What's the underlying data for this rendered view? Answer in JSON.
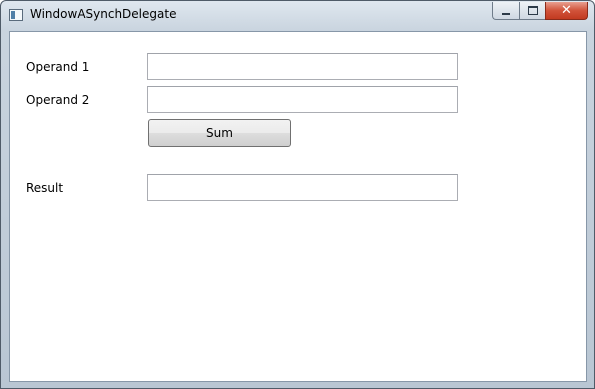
{
  "window": {
    "title": "WindowASynchDelegate",
    "icon": "wpf-window-icon",
    "caption_buttons": {
      "minimize": "minimize-icon",
      "maximize": "maximize-icon",
      "close": "close-icon",
      "close_glyph": "✕"
    }
  },
  "form": {
    "operand1": {
      "label": "Operand 1",
      "value": ""
    },
    "operand2": {
      "label": "Operand 2",
      "value": ""
    },
    "sum_button_label": "Sum",
    "result": {
      "label": "Result",
      "value": ""
    }
  },
  "colors": {
    "close_button": "#c7432a",
    "frame": "#c9d4df",
    "client_background": "#ffffff"
  }
}
